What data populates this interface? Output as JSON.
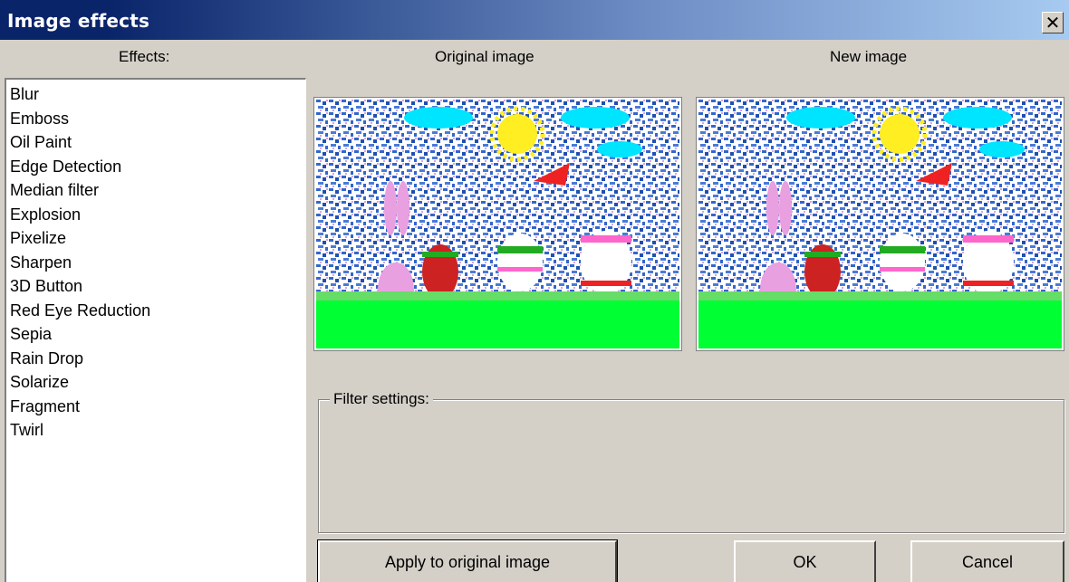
{
  "window": {
    "title": "Image effects",
    "close_glyph": "✕"
  },
  "headers": {
    "effects": "Effects:",
    "original": "Original image",
    "new": "New image"
  },
  "effects_list": [
    "Blur",
    "Emboss",
    "Oil Paint",
    "Edge Detection",
    "Median filter",
    "Explosion",
    "Pixelize",
    "Sharpen",
    "3D Button",
    "Red Eye Reduction",
    "Sepia",
    "Rain Drop",
    "Solarize",
    "Fragment",
    "Twirl"
  ],
  "filter_settings": {
    "label": "Filter settings:"
  },
  "buttons": {
    "apply": "Apply to original image",
    "ok": "OK",
    "cancel": "Cancel"
  },
  "colors": {
    "title_start": "#0a246a",
    "title_end": "#a6caf0",
    "dialog_bg": "#d4d0c8",
    "grass": "#00ff33",
    "sky": "#3366cc"
  },
  "icons": {
    "close": "close-icon"
  }
}
